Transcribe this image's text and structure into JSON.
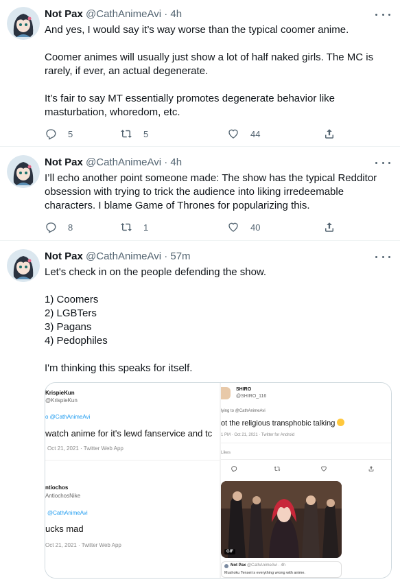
{
  "tweets": [
    {
      "author": {
        "name": "Not Pax",
        "handle": "@CathAnimeAvi",
        "time": "4h"
      },
      "text": "And yes, I would say it’s way worse than the typical coomer anime.\n\nCoomer animes will usually just show a lot of half naked girls. The MC is rarely, if ever, an actual degenerate.\n\nIt’s fair to say MT essentially promotes degenerate behavior like masturbation, whoredom, etc.",
      "replies": "5",
      "retweets": "5",
      "likes": "44"
    },
    {
      "author": {
        "name": "Not Pax",
        "handle": "@CathAnimeAvi",
        "time": "4h"
      },
      "text": "I’ll echo another point someone made: The show has the typical Redditor obsession with trying to trick the audience into liking irredeemable characters. I blame Game of Thrones for popularizing this.",
      "replies": "8",
      "retweets": "1",
      "likes": "40"
    },
    {
      "author": {
        "name": "Not Pax",
        "handle": "@CathAnimeAvi",
        "time": "57m"
      },
      "text": "Let's check in on the people defending the show.\n\n1) Coomers\n2) LGBTers\n3) Pagans\n4) Pedophiles\n\nI'm thinking this speaks for itself."
    }
  ],
  "dot": "·",
  "media": {
    "left": {
      "post1": {
        "name": "KrispieKun",
        "handle": "@KrispieKun",
        "reply": "o @CathAnimeAvi",
        "text": "watch anime for it's lewd fanservice and tc",
        "meta": "Oct 21, 2021 · Twitter Web App"
      },
      "post2": {
        "name": "ntiochos",
        "handle": "AntiochosNike",
        "reply": "@CathAnimeAvi",
        "text": "ucks mad",
        "meta": "Oct 21, 2021 · Twitter Web App"
      }
    },
    "right": {
      "name": "SHIRO",
      "handle": "@SHIRO_116",
      "reply": "lying to @CathAnimeAvi",
      "text": "ot the religious transphobic talking",
      "meta": "1 PM · Oct 21, 2021 · Twitter for Android",
      "likes_label": "Likes",
      "gif_badge": "GIF",
      "quote_author": "Not Pax",
      "quote_handle": "@CathAnimeAvi · 4h",
      "quote_text": "Mushoku Tensei is everything wrong with anime."
    }
  }
}
